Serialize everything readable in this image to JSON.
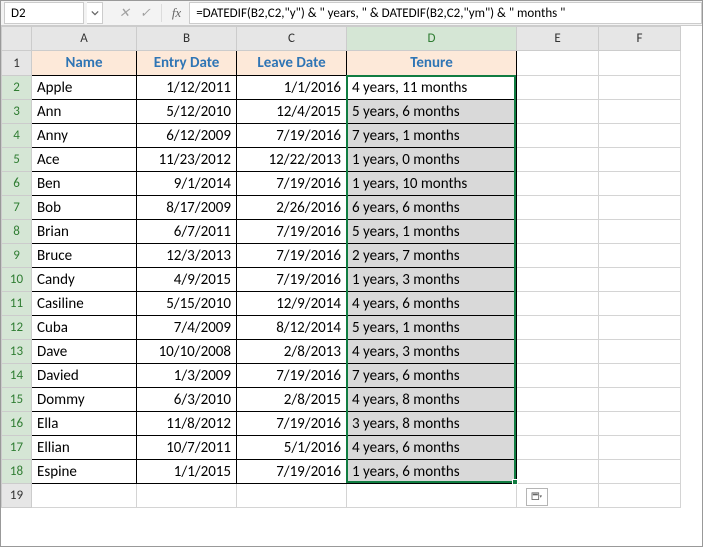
{
  "chart_data": {
    "type": "table",
    "columns": [
      "Name",
      "Entry Date",
      "Leave Date",
      "Tenure"
    ],
    "rows": [
      [
        "Apple",
        "1/12/2011",
        "1/1/2016",
        "4 years, 11 months"
      ],
      [
        "Ann",
        "5/12/2010",
        "12/4/2015",
        "5 years, 6 months"
      ],
      [
        "Anny",
        "6/12/2009",
        "7/19/2016",
        "7 years, 1 months"
      ],
      [
        "Ace",
        "11/23/2012",
        "12/22/2013",
        "1 years, 0 months"
      ],
      [
        "Ben",
        "9/1/2014",
        "7/19/2016",
        "1 years, 10 months"
      ],
      [
        "Bob",
        "8/17/2009",
        "2/26/2016",
        "6 years, 6 months"
      ],
      [
        "Brian",
        "6/7/2011",
        "7/19/2016",
        "5 years, 1 months"
      ],
      [
        "Bruce",
        "12/3/2013",
        "7/19/2016",
        "2 years, 7 months"
      ],
      [
        "Candy",
        "4/9/2015",
        "7/19/2016",
        "1 years, 3 months"
      ],
      [
        "Casiline",
        "5/15/2010",
        "12/9/2014",
        "4 years, 6 months"
      ],
      [
        "Cuba",
        "7/4/2009",
        "8/12/2014",
        "5 years, 1 months"
      ],
      [
        "Dave",
        "10/10/2008",
        "2/8/2013",
        "4 years, 3 months"
      ],
      [
        "Davied",
        "1/3/2009",
        "7/19/2016",
        "7 years, 6 months"
      ],
      [
        "Dommy",
        "6/3/2010",
        "2/8/2015",
        "4 years, 8 months"
      ],
      [
        "Ella",
        "11/8/2012",
        "7/19/2016",
        "3 years, 8 months"
      ],
      [
        "Ellian",
        "10/7/2011",
        "5/1/2016",
        "4 years, 6 months"
      ],
      [
        "Espine",
        "1/1/2015",
        "7/19/2016",
        "1 years, 6 months"
      ]
    ]
  },
  "namebox": "D2",
  "formula": "=DATEDIF(B2,C2,\"y\") & \" years, \" & DATEDIF(B2,C2,\"ym\") & \" months \"",
  "col_letters": [
    "A",
    "B",
    "C",
    "D",
    "E",
    "F"
  ],
  "headers": {
    "A": "Name",
    "B": "Entry Date",
    "C": "Leave Date",
    "D": "Tenure"
  },
  "rows": [
    {
      "n": "2",
      "name": "Apple",
      "entry": "1/12/2011",
      "leave": "1/1/2016",
      "tenure": "4 years, 11 months",
      "sel_first": true
    },
    {
      "n": "3",
      "name": "Ann",
      "entry": "5/12/2010",
      "leave": "12/4/2015",
      "tenure": "5 years, 6 months"
    },
    {
      "n": "4",
      "name": "Anny",
      "entry": "6/12/2009",
      "leave": "7/19/2016",
      "tenure": "7 years, 1 months"
    },
    {
      "n": "5",
      "name": "Ace",
      "entry": "11/23/2012",
      "leave": "12/22/2013",
      "tenure": "1 years, 0 months"
    },
    {
      "n": "6",
      "name": "Ben",
      "entry": "9/1/2014",
      "leave": "7/19/2016",
      "tenure": "1 years, 10 months"
    },
    {
      "n": "7",
      "name": "Bob",
      "entry": "8/17/2009",
      "leave": "2/26/2016",
      "tenure": "6 years, 6 months"
    },
    {
      "n": "8",
      "name": "Brian",
      "entry": "6/7/2011",
      "leave": "7/19/2016",
      "tenure": "5 years, 1 months"
    },
    {
      "n": "9",
      "name": "Bruce",
      "entry": "12/3/2013",
      "leave": "7/19/2016",
      "tenure": "2 years, 7 months"
    },
    {
      "n": "10",
      "name": "Candy",
      "entry": "4/9/2015",
      "leave": "7/19/2016",
      "tenure": "1 years, 3 months"
    },
    {
      "n": "11",
      "name": "Casiline",
      "entry": "5/15/2010",
      "leave": "12/9/2014",
      "tenure": "4 years, 6 months"
    },
    {
      "n": "12",
      "name": "Cuba",
      "entry": "7/4/2009",
      "leave": "8/12/2014",
      "tenure": "5 years, 1 months"
    },
    {
      "n": "13",
      "name": "Dave",
      "entry": "10/10/2008",
      "leave": "2/8/2013",
      "tenure": "4 years, 3 months"
    },
    {
      "n": "14",
      "name": "Davied",
      "entry": "1/3/2009",
      "leave": "7/19/2016",
      "tenure": "7 years, 6 months"
    },
    {
      "n": "15",
      "name": "Dommy",
      "entry": "6/3/2010",
      "leave": "2/8/2015",
      "tenure": "4 years, 8 months"
    },
    {
      "n": "16",
      "name": "Ella",
      "entry": "11/8/2012",
      "leave": "7/19/2016",
      "tenure": "3 years, 8 months"
    },
    {
      "n": "17",
      "name": "Ellian",
      "entry": "10/7/2011",
      "leave": "5/1/2016",
      "tenure": "4 years, 6 months"
    },
    {
      "n": "18",
      "name": "Espine",
      "entry": "1/1/2015",
      "leave": "7/19/2016",
      "tenure": "1 years, 6 months"
    }
  ],
  "empty_row": "19"
}
